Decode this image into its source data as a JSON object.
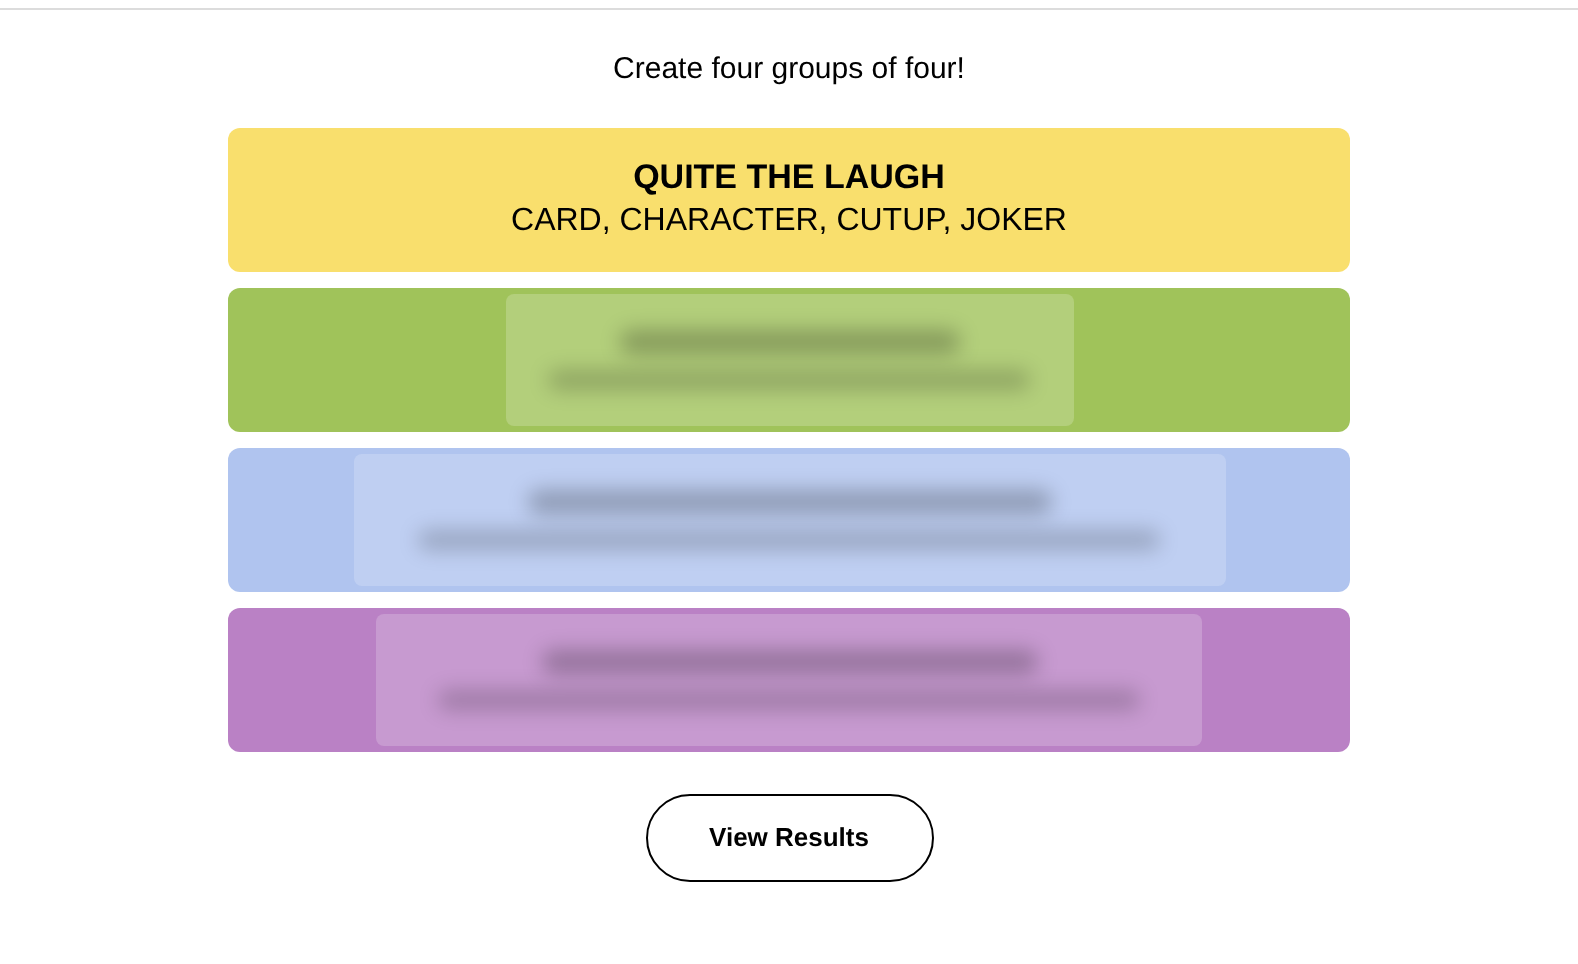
{
  "instructions": "Create four groups of four!",
  "groups": [
    {
      "kind": "revealed",
      "color": "#f9df6d",
      "title": "QUITE THE LAUGH",
      "members": "CARD, CHARACTER, CUTUP, JOKER"
    },
    {
      "kind": "blurred",
      "color": "#a0c35a"
    },
    {
      "kind": "blurred",
      "color": "#b0c4ef"
    },
    {
      "kind": "blurred",
      "color": "#ba81c5"
    }
  ],
  "button": "View Results"
}
